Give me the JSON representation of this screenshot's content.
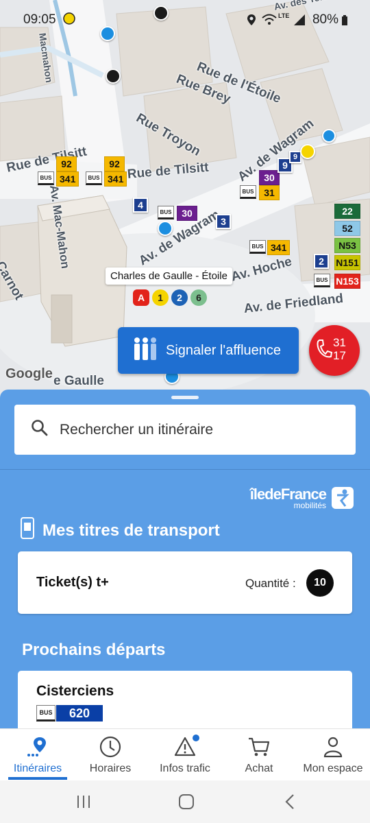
{
  "status_bar": {
    "time": "09:05",
    "battery": "80%",
    "network": "LTE",
    "icons": [
      "location-icon",
      "wifi-icon",
      "signal-icon",
      "battery-icon"
    ]
  },
  "map": {
    "streets": [
      "Rue de Tilsitt",
      "Rue de l'Étoile",
      "Rue Brey",
      "Rue Troyon",
      "Av. Mac-Mahon",
      "Av. de Wagram",
      "Av. Hoche",
      "Av. de Friedland",
      "Carnot",
      "Av. des Ternes",
      "Rue de Tilsitt",
      "Av. de Wagram",
      "e Gaulle",
      "Macmahon"
    ],
    "bus_label": "BUS",
    "bus_lines": [
      "92",
      "341",
      "92",
      "341",
      "30",
      "341",
      "30",
      "31",
      "22",
      "52",
      "N53",
      "N151",
      "N153"
    ],
    "metro_markers": [
      "4",
      "3",
      "2",
      "9",
      "9"
    ],
    "station": {
      "name": "Charles de Gaulle - Étoile",
      "lines": [
        "A",
        "1",
        "2",
        "6"
      ]
    },
    "google_logo": "Google",
    "colors": {
      "metro": "#1d3f8f",
      "bus_30": "#6b1f8f",
      "bus_yellow": "#f5b800",
      "bus_22": "#1b6b3a",
      "bus_52": "#8ec8e8",
      "bus_n53": "#7ac143",
      "bus_n151": "#c9c400",
      "bus_n153": "#e2231a",
      "rer_a": "#e2231a",
      "line_1": "#f5d400",
      "line_2": "#1d62b5",
      "line_6": "#7cbf8e"
    }
  },
  "affluence_button": {
    "label": "Signaler l'affluence",
    "icon": "people-icon"
  },
  "phone_fab": {
    "number_line1": "31",
    "number_line2": "17",
    "icon": "phone-icon",
    "color": "#e21f26"
  },
  "search": {
    "placeholder": "Rechercher un itinéraire",
    "icon": "search-icon"
  },
  "brand": {
    "name": "îledeFrance",
    "sub": "mobilités"
  },
  "titles": {
    "heading": "Mes titres de transport",
    "ticket_name": "Ticket(s) t+",
    "quantity_label": "Quantité :",
    "quantity": "10"
  },
  "departures": {
    "heading": "Prochains départs",
    "stop_name": "Cisterciens",
    "bus_label": "BUS",
    "line": "620",
    "line_color": "#0a3fa6"
  },
  "bottom_nav": {
    "items": [
      {
        "label": "Itinéraires",
        "icon": "route-pin-icon",
        "active": true
      },
      {
        "label": "Horaires",
        "icon": "clock-icon",
        "active": false
      },
      {
        "label": "Infos trafic",
        "icon": "warning-icon",
        "active": false,
        "badge": true
      },
      {
        "label": "Achat",
        "icon": "cart-icon",
        "active": false
      },
      {
        "label": "Mon espace",
        "icon": "user-icon",
        "active": false
      }
    ],
    "accent": "#1f6fd1"
  },
  "system_nav": {
    "buttons": [
      "recents-icon",
      "home-icon",
      "back-icon"
    ]
  }
}
